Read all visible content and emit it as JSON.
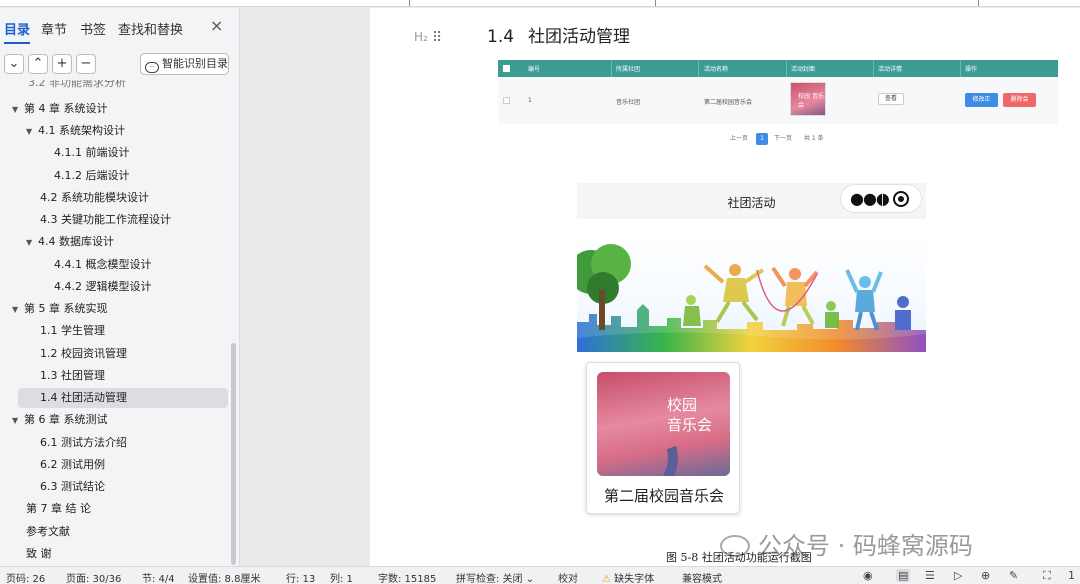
{
  "nav": {
    "tabs": [
      {
        "label": "目录",
        "active": true
      },
      {
        "label": "章节"
      },
      {
        "label": "书签"
      },
      {
        "label": "查找和替换"
      }
    ],
    "close": "×",
    "tools": {
      "down": "⌄",
      "up": "⌃",
      "plus": "+",
      "minus": "−"
    },
    "smart_label": "智能识别目录",
    "toc": [
      {
        "text": "3.2  非功能需求分析"
      },
      {
        "text": "第 4 章  系统设计"
      },
      {
        "text": "4.1   系统架构设计"
      },
      {
        "text": "4.1.1    前端设计"
      },
      {
        "text": "4.1.2    后端设计"
      },
      {
        "text": "4.2   系统功能模块设计"
      },
      {
        "text": "4.3   关键功能工作流程设计"
      },
      {
        "text": "4.4   数据库设计"
      },
      {
        "text": "4.4.1    概念模型设计"
      },
      {
        "text": "4.4.2    逻辑模型设计"
      },
      {
        "text": "第 5 章  系统实现"
      },
      {
        "text": "1.1  学生管理"
      },
      {
        "text": "1.2  校园资讯管理"
      },
      {
        "text": "1.3  社团管理"
      },
      {
        "text": "1.4  社团活动管理"
      },
      {
        "text": "第 6 章  系统测试"
      },
      {
        "text": "6.1   测试方法介绍"
      },
      {
        "text": "6.2   测试用例"
      },
      {
        "text": "6.3   测试结论"
      },
      {
        "text": "第 7 章   结      论"
      },
      {
        "text": "参考文献"
      },
      {
        "text": "致      谢"
      }
    ]
  },
  "doc": {
    "heading_marker": "H₂",
    "section_number": "1.4",
    "section_title": "社团活动管理",
    "table": {
      "headers": [
        "编号",
        "所属社团",
        "活动名称",
        "活动封面",
        "活动详情",
        "操作"
      ],
      "row": {
        "id": "1",
        "club": "音乐社团",
        "name": "第二届校园音乐会",
        "cover_text": "校园 音乐会",
        "view": "查看",
        "edit": "修改正",
        "delete": "删除会"
      }
    },
    "pager": {
      "prev": "上一页",
      "current": "1",
      "next": "下一页",
      "total": "共 1 条"
    },
    "phone": {
      "title": "社团活动",
      "poster_line1": "校园",
      "poster_line2": "音乐会",
      "card_caption": "第二届校园音乐会"
    },
    "watermark": "公众号 · 码蜂窝源码",
    "figure_caption": "图 5-8  社团活动功能运行截图"
  },
  "status": {
    "page_code": "页码: 26",
    "page": "页面: 30/36",
    "section": "节: 4/4",
    "setting": "设置值: 8.8厘米",
    "row": "行: 13",
    "col": "列: 1",
    "words": "字数: 15185",
    "spell": "拼写检查: 关闭",
    "proof": "校对",
    "missing_font": "缺失字体",
    "compat": "兼容模式",
    "last": "1"
  }
}
